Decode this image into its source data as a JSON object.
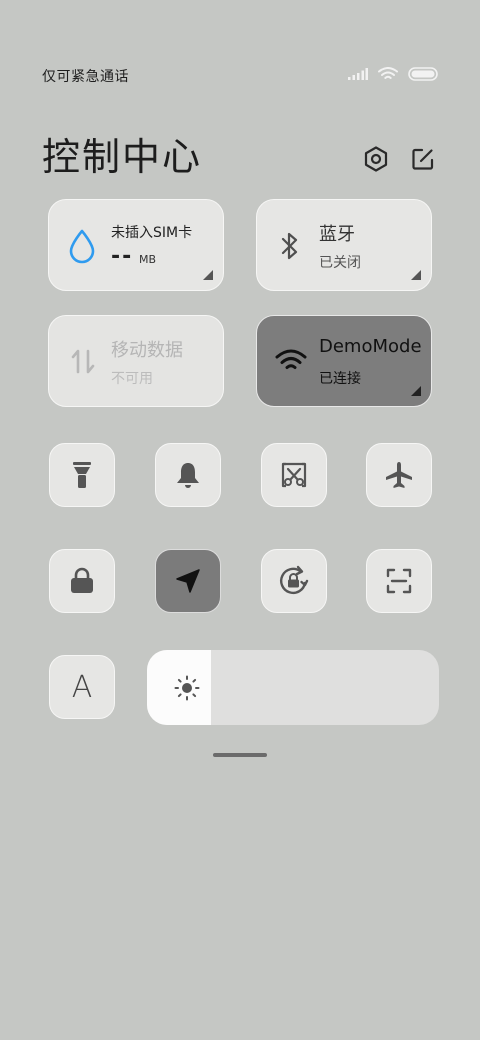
{
  "status_bar": {
    "carrier_text": "仅可紧急通话",
    "icons": [
      "signal-icon",
      "wifi-icon",
      "battery-icon"
    ]
  },
  "header": {
    "title": "控制中心",
    "settings_icon": "gear-icon",
    "edit_icon": "edit-icon"
  },
  "cards": {
    "data_usage": {
      "label": "未插入SIM卡",
      "value": "--",
      "unit": "MB",
      "icon": "water-drop-icon"
    },
    "bluetooth": {
      "label": "蓝牙",
      "status": "已关闭",
      "icon": "bluetooth-icon"
    },
    "mobile_data": {
      "label": "移动数据",
      "status": "不可用",
      "icon": "data-arrows-icon"
    },
    "wifi": {
      "label": "DemoMode",
      "status": "已连接",
      "icon": "wifi-icon"
    }
  },
  "toggles": [
    {
      "name": "flashlight",
      "icon": "flashlight-icon",
      "active": false
    },
    {
      "name": "bell",
      "icon": "bell-icon",
      "active": false
    },
    {
      "name": "screenshot",
      "icon": "scissors-icon",
      "active": false
    },
    {
      "name": "airplane",
      "icon": "airplane-icon",
      "active": false
    },
    {
      "name": "lock",
      "icon": "lock-icon",
      "active": false
    },
    {
      "name": "location",
      "icon": "location-arrow-icon",
      "active": true
    },
    {
      "name": "rotation-lock",
      "icon": "rotation-lock-icon",
      "active": false
    },
    {
      "name": "scan",
      "icon": "scan-icon",
      "active": false
    }
  ],
  "font_size_toggle": {
    "label": "A",
    "icon": "font-icon"
  },
  "brightness": {
    "level_percent": 22,
    "icon": "sun-icon"
  },
  "colors": {
    "background": "#c5c7c4",
    "tile": "#e6e6e4",
    "tile_active": "#7b7b7b",
    "accent_blue": "#2f9bef"
  }
}
